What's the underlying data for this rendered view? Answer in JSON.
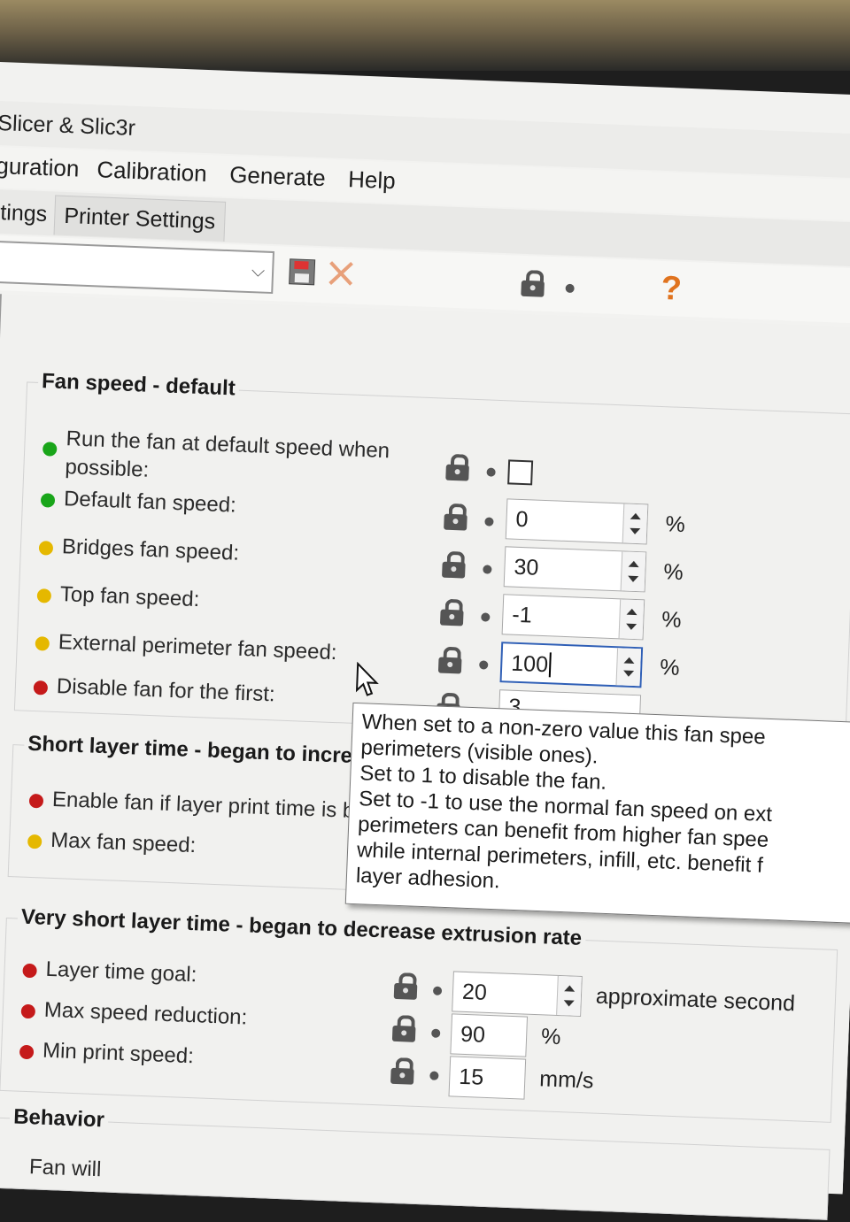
{
  "window": {
    "title": "Slicer & Slic3r"
  },
  "menu": [
    "guration",
    "Calibration",
    "Generate",
    "Help"
  ],
  "tabs": [
    {
      "label": "ttings",
      "active": false
    },
    {
      "label": "Printer Settings",
      "active": true
    }
  ],
  "toolbar": {
    "preset_value": "",
    "icons": [
      "combo-dropdown-icon",
      "save-icon",
      "delete-icon",
      "lock-icon",
      "dot-icon",
      "help-icon"
    ],
    "help_text": "?"
  },
  "groups": {
    "fan_default": {
      "title": "Fan speed - default",
      "rows": [
        {
          "label": "Run the fan at default speed when",
          "label2": "possible:",
          "dot": "green",
          "control": "checkbox",
          "checked": false
        },
        {
          "label": "Default fan speed:",
          "dot": "green",
          "value": "0",
          "unit": "%"
        },
        {
          "label": "Bridges fan speed:",
          "dot": "yellow",
          "value": "30",
          "unit": "%"
        },
        {
          "label": "Top fan speed:",
          "dot": "yellow",
          "value": "-1",
          "unit": "%"
        },
        {
          "label": "External perimeter fan speed:",
          "dot": "yellow",
          "value": "100",
          "unit": "%",
          "focused": true
        },
        {
          "label": "Disable fan for the first:",
          "dot": "red",
          "value": "3"
        }
      ]
    },
    "short_layer": {
      "title": "Short layer time - began to incre",
      "rows": [
        {
          "label": "Enable fan if layer print time is b",
          "dot": "red"
        },
        {
          "label": "Max fan speed:",
          "dot": "yellow"
        }
      ]
    },
    "very_short": {
      "title": "Very short layer time - began to decrease extrusion rate",
      "rows": [
        {
          "label": "Layer time goal:",
          "dot": "red",
          "value": "20",
          "unit": "approximate second"
        },
        {
          "label": "Max speed reduction:",
          "dot": "red",
          "value": "90",
          "unit": "%"
        },
        {
          "label": "Min print speed:",
          "dot": "red",
          "value": "15",
          "unit": "mm/s"
        }
      ]
    },
    "behavior": {
      "title": "Behavior",
      "row_label": "Fan will"
    }
  },
  "tooltip": {
    "lines": [
      "When set to a non-zero value this fan spee",
      "perimeters (visible ones).",
      "Set to 1 to disable the fan.",
      "Set to -1 to use the normal fan speed on ext",
      "perimeters can benefit from higher fan spee",
      "while internal perimeters, infill, etc. benefit f",
      "layer adhesion."
    ]
  },
  "colors": {
    "dot_green": "#19a519",
    "dot_yellow": "#e5b800",
    "dot_red": "#c51a1a",
    "help_orange": "#e0731e",
    "focus_blue": "#2f5fb6"
  }
}
